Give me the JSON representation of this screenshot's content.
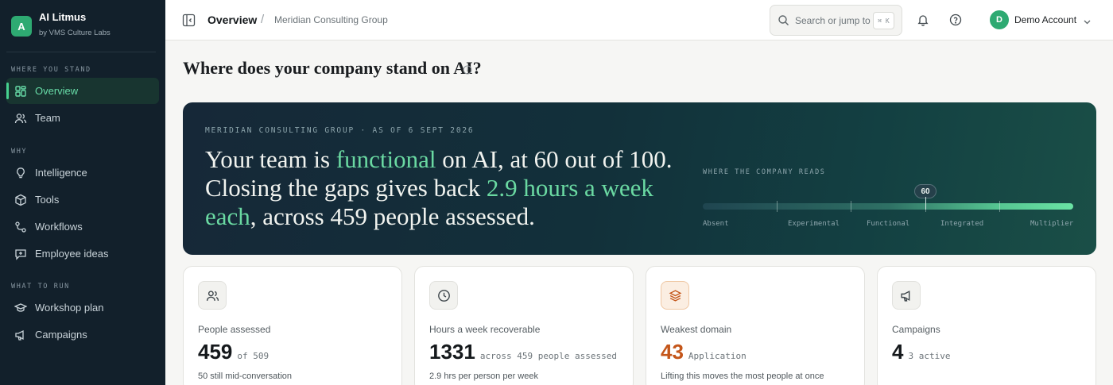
{
  "brand": {
    "initial": "A",
    "name": "AI Litmus",
    "subtitle": "by VMS Culture Labs",
    "accent_color": "#2eaa72"
  },
  "sidebar": {
    "sections": [
      {
        "label": "WHERE YOU STAND",
        "items": [
          {
            "label": "Overview",
            "icon": "grid-icon",
            "active": true
          },
          {
            "label": "Team",
            "icon": "users-icon",
            "active": false
          }
        ]
      },
      {
        "label": "WHY",
        "items": [
          {
            "label": "Intelligence",
            "icon": "lightbulb-icon",
            "active": false
          },
          {
            "label": "Tools",
            "icon": "box-icon",
            "active": false
          },
          {
            "label": "Workflows",
            "icon": "workflow-icon",
            "active": false
          },
          {
            "label": "Employee ideas",
            "icon": "message-plus-icon",
            "active": false
          }
        ]
      },
      {
        "label": "WHAT TO RUN",
        "items": [
          {
            "label": "Workshop plan",
            "icon": "graduation-cap-icon",
            "active": false
          },
          {
            "label": "Campaigns",
            "icon": "megaphone-icon",
            "active": false
          }
        ]
      }
    ]
  },
  "topbar": {
    "title": "Overview",
    "separator": "/",
    "organization": "Meridian Consulting Group",
    "search_placeholder": "Search or jump to",
    "search_shortcut": "⌘ K",
    "account_initial": "D",
    "account_name": "Demo Account"
  },
  "page": {
    "title": "Where does your company stand on AI?"
  },
  "hero": {
    "kicker": "MERIDIAN CONSULTING GROUP · AS OF 6 SEPT 2026",
    "headline": {
      "part1": "Your team is ",
      "level": "functional",
      "part2": " on AI, at 60 out of 100. Closing the gaps gives back ",
      "hours": "2.9 hours a week each",
      "part3": ", across 459 people assessed."
    },
    "scale": {
      "label": "WHERE THE COMPANY READS",
      "score": 60,
      "score_label": "60",
      "max": 100,
      "stages": [
        "Absent",
        "Experimental",
        "Functional",
        "Integrated",
        "Multiplier"
      ]
    }
  },
  "cards": [
    {
      "icon": "users-icon",
      "label": "People assessed",
      "value": "459",
      "suffix": "of 509",
      "foot": "50 still mid-conversation",
      "warn": false
    },
    {
      "icon": "clock-icon",
      "label": "Hours a week recoverable",
      "value": "1331",
      "suffix": "across 459 people assessed",
      "foot": "2.9 hrs per person per week",
      "warn": false
    },
    {
      "icon": "layers-icon",
      "label": "Weakest domain",
      "value": "43",
      "suffix": "Application",
      "foot": "Lifting this moves the most people at once",
      "warn": true
    },
    {
      "icon": "megaphone-icon",
      "label": "Campaigns",
      "value": "4",
      "suffix": "3 active",
      "foot": "",
      "warn": false
    }
  ],
  "colors": {
    "sidebar_bg": "#12202b",
    "active_accent": "#46d08f",
    "highlight": "#6ad9a2",
    "warn": "#c4561a"
  }
}
